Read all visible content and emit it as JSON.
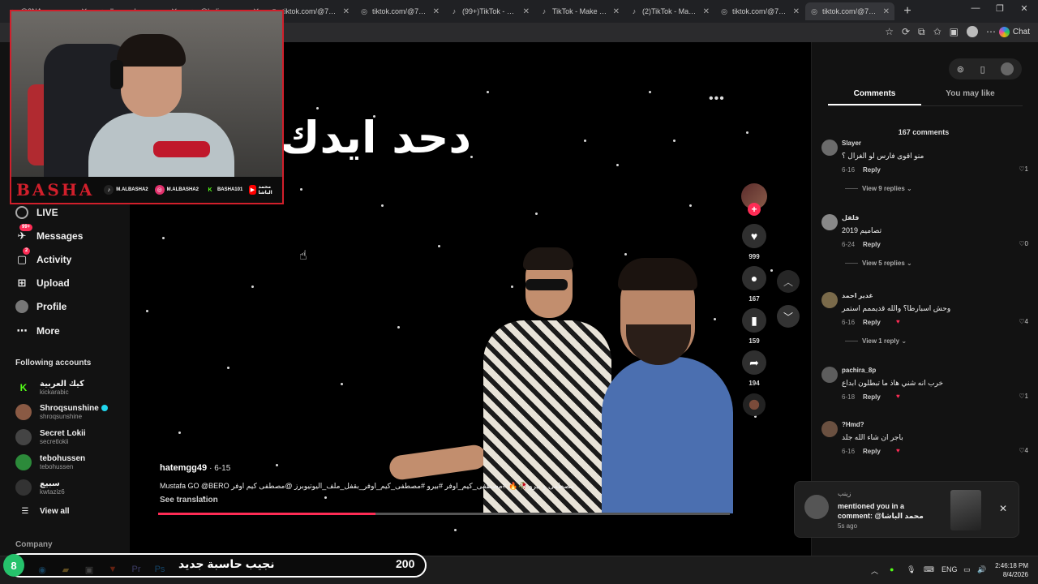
{
  "browser": {
    "tabs": [
      {
        "title": "@3NA..",
        "icon": "tiktok"
      },
      {
        "title": "lkeeped..",
        "icon": "tiktok"
      },
      {
        "title": "@ladi..",
        "icon": "tiktok"
      },
      {
        "title": "tiktok.com/@73908",
        "icon": "globe"
      },
      {
        "title": "tiktok.com/@75893",
        "icon": "globe"
      },
      {
        "title": "(99+)TikTok - Make",
        "icon": "tiktok"
      },
      {
        "title": "TikTok - Make Your",
        "icon": "tiktok"
      },
      {
        "title": "(2)TikTok - Make Yo",
        "icon": "tiktok"
      },
      {
        "title": "tiktok.com/@73380",
        "icon": "globe"
      },
      {
        "title": "tiktok.com/@73380",
        "icon": "globe"
      }
    ],
    "chat_label": "Chat"
  },
  "sidebar": {
    "nav": [
      {
        "label": "LIVE",
        "icon": "live-icon",
        "badge": ""
      },
      {
        "label": "Messages",
        "icon": "messages-icon",
        "badge": "99+"
      },
      {
        "label": "Activity",
        "icon": "activity-icon",
        "badge": "2"
      },
      {
        "label": "Upload",
        "icon": "upload-icon",
        "badge": ""
      },
      {
        "label": "Profile",
        "icon": "profile-icon",
        "badge": ""
      },
      {
        "label": "More",
        "icon": "more-icon",
        "badge": ""
      }
    ],
    "following_title": "Following accounts",
    "accounts": [
      {
        "name": "كيك العربية",
        "handle": "kickarabic",
        "color": "#53fc18",
        "glyph": "K",
        "verified": false
      },
      {
        "name": "Shroqsunshine",
        "handle": "shroqsunshine",
        "color": "#8a5a44",
        "glyph": "",
        "verified": true
      },
      {
        "name": "Secret Lokii",
        "handle": "secretlokii",
        "color": "#444",
        "glyph": "",
        "verified": false
      },
      {
        "name": "tebohussen",
        "handle": "tebohussen",
        "color": "#2c8a3a",
        "glyph": "",
        "verified": false
      },
      {
        "name": "سبيع",
        "handle": "kwtaziz6",
        "color": "#333",
        "glyph": "",
        "verified": false
      }
    ],
    "view_all": "View all",
    "company": "Company"
  },
  "streamer": {
    "brand": "BASHA",
    "socials": [
      {
        "label": "M.ALBASHA2",
        "color": "#000",
        "icon": "tiktok"
      },
      {
        "label": "M.ALBASHA2",
        "color": "#e1306c",
        "icon": "instagram"
      },
      {
        "label": "BASHA101",
        "color": "#53fc18",
        "icon": "kick"
      },
      {
        "label": "محمد الباشا",
        "color": "#ff0000",
        "icon": "youtube"
      }
    ]
  },
  "video": {
    "overlay_title": "دحد ايدك",
    "author": "hatemgg49",
    "date": "· 6-15",
    "caption": "مصطفى و بيرو 🥀🔥 #مصطفى_كيم_اوفر #بيرو #مصطفى_كيم_اوفر_بقفل_ملف_اليوتيوبرز @مصطفى كيم اوفر Mustafa GO @BERO",
    "see_translation": "See translation",
    "progress": 0.38
  },
  "actions": {
    "likes": "999",
    "comments": "167",
    "saves": "159",
    "shares": "194"
  },
  "comments_panel": {
    "tab_comments": "Comments",
    "tab_you_may_like": "You may like",
    "count_label": "167 comments",
    "items": [
      {
        "user": "Slayer",
        "text": "منو اقوى فارس لو الغزال ؟",
        "date": "6-16",
        "likes": "1",
        "creator_liked": false,
        "view_replies": "View 9 replies"
      },
      {
        "user": "فلفل",
        "text": "تصاميم 2019",
        "date": "6-24",
        "likes": "0",
        "creator_liked": false,
        "view_replies": "View 5 replies"
      },
      {
        "user": "غدير احمد",
        "text": "وحش اسبارطا؟ والله قديممم استمر",
        "date": "6-16",
        "likes": "4",
        "creator_liked": true,
        "view_replies": "View 1 reply"
      },
      {
        "user": "pachira_8p",
        "text": "خرب انه شني هاذ ما تبطلون ابداع",
        "date": "6-18",
        "likes": "1",
        "creator_liked": true,
        "view_replies": ""
      },
      {
        "user": "?Hmd?",
        "text": "باجر ان شاء الله جلد",
        "date": "6-16",
        "likes": "4",
        "creator_liked": true,
        "view_replies": ""
      }
    ],
    "reply_label": "Reply"
  },
  "notification": {
    "from": "زينب",
    "text": "mentioned you in a comment: @محمد الباشا",
    "time": "5s ago"
  },
  "stream_goal": {
    "level": "8",
    "text": "نجيب حاسبة جديد",
    "value": "200"
  },
  "taskbar": {
    "lang": "ENG",
    "time": "2:46:18 PM",
    "date": "8/4/2026"
  }
}
